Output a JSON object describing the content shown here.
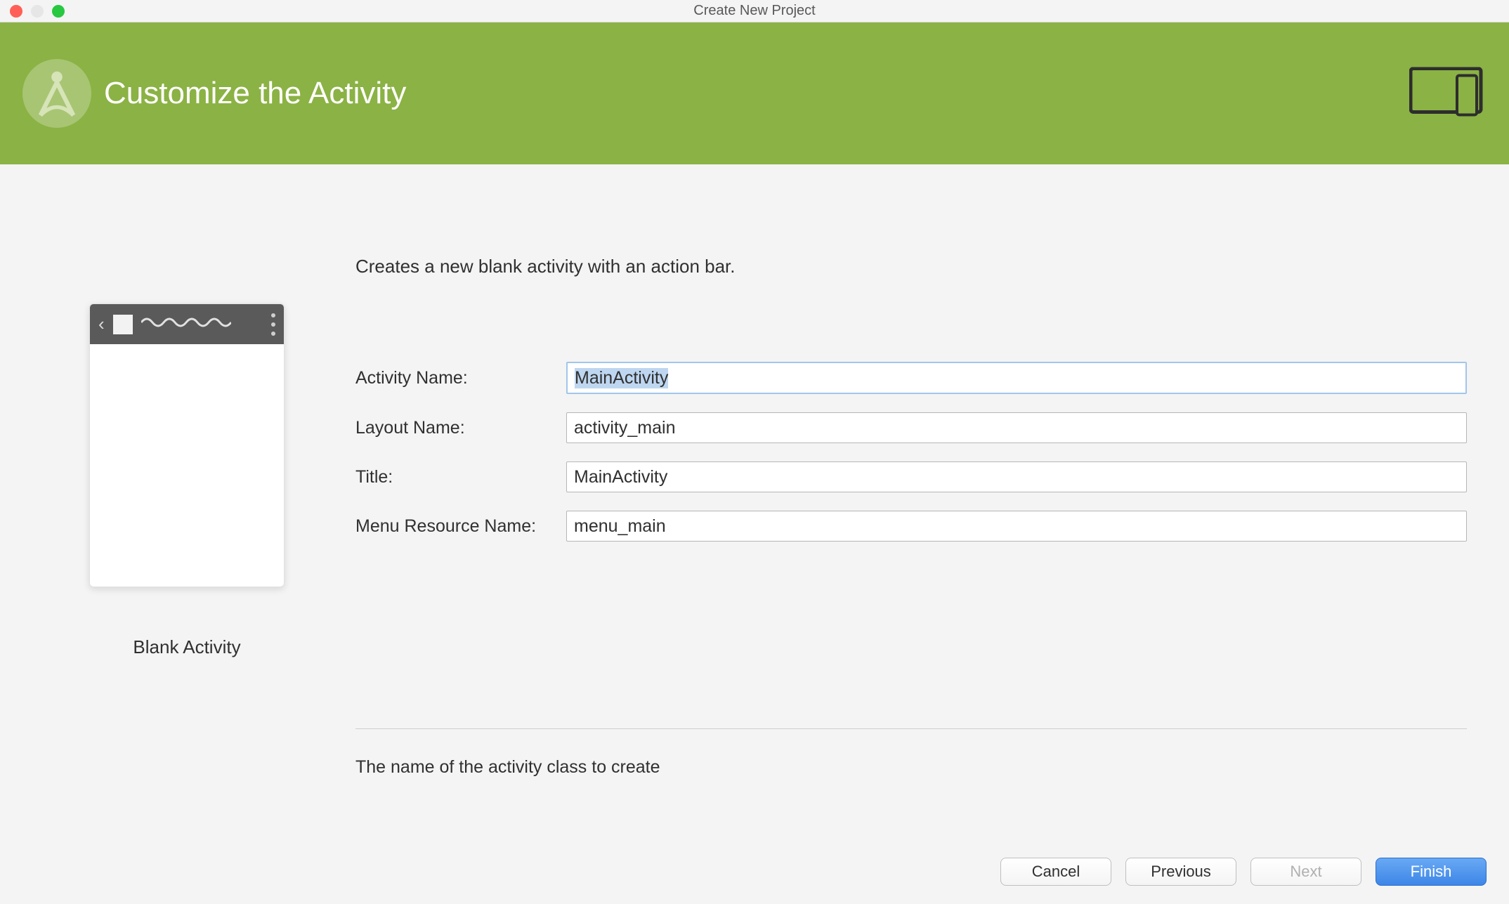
{
  "window": {
    "title": "Create New Project"
  },
  "banner": {
    "title": "Customize the Activity"
  },
  "preview": {
    "label": "Blank Activity"
  },
  "content": {
    "description": "Creates a new blank activity with an action bar.",
    "hint": "The name of the activity class to create"
  },
  "form": {
    "activity_name": {
      "label": "Activity Name:",
      "value": "MainActivity"
    },
    "layout_name": {
      "label": "Layout Name:",
      "value": "activity_main"
    },
    "title": {
      "label": "Title:",
      "value": "MainActivity"
    },
    "menu_resource": {
      "label": "Menu Resource Name:",
      "value": "menu_main"
    }
  },
  "buttons": {
    "cancel": "Cancel",
    "previous": "Previous",
    "next": "Next",
    "finish": "Finish"
  }
}
